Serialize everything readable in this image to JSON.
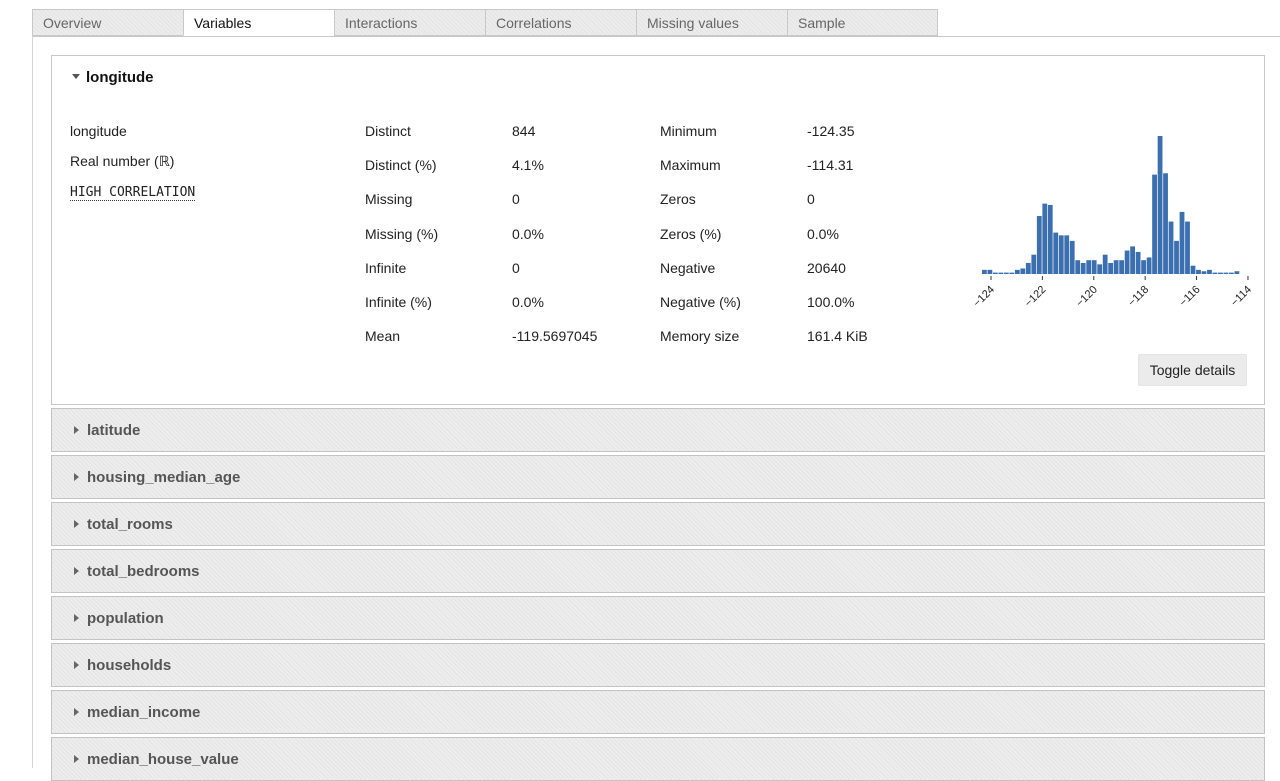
{
  "tabs": [
    "Overview",
    "Variables",
    "Interactions",
    "Correlations",
    "Missing values",
    "Sample"
  ],
  "active_tab": "Variables",
  "variable": {
    "name": "longitude",
    "display_name": "longitude",
    "type": "Real number (ℝ)",
    "alert": "HIGH CORRELATION",
    "stats_left": [
      {
        "label": "Distinct",
        "value": "844"
      },
      {
        "label": "Distinct (%)",
        "value": "4.1%"
      },
      {
        "label": "Missing",
        "value": "0"
      },
      {
        "label": "Missing (%)",
        "value": "0.0%"
      },
      {
        "label": "Infinite",
        "value": "0"
      },
      {
        "label": "Infinite (%)",
        "value": "0.0%"
      },
      {
        "label": "Mean",
        "value": "-119.5697045"
      }
    ],
    "stats_right": [
      {
        "label": "Minimum",
        "value": "-124.35"
      },
      {
        "label": "Maximum",
        "value": "-114.31"
      },
      {
        "label": "Zeros",
        "value": "0"
      },
      {
        "label": "Zeros (%)",
        "value": "0.0%"
      },
      {
        "label": "Negative",
        "value": "20640"
      },
      {
        "label": "Negative (%)",
        "value": "100.0%"
      },
      {
        "label": "Memory size",
        "value": "161.4 KiB"
      }
    ],
    "toggle_label": "Toggle details"
  },
  "chart_data": {
    "type": "bar",
    "bar_color": "#3c6fb0",
    "xlim": [
      -124.35,
      -114.31
    ],
    "ticks": [
      "−124",
      "−122",
      "−120",
      "−118",
      "−116",
      "−114"
    ],
    "tick_values": [
      -124,
      -122,
      -120,
      -118,
      -116,
      -114
    ],
    "values": [
      3,
      3,
      1,
      1,
      1,
      1,
      3,
      4,
      8,
      14,
      42,
      51,
      50,
      30,
      28,
      28,
      24,
      10,
      8,
      10,
      10,
      7,
      14,
      8,
      10,
      10,
      17,
      20,
      16,
      10,
      12,
      72,
      100,
      73,
      38,
      24,
      45,
      38,
      6,
      3,
      2,
      3,
      1,
      1,
      1,
      1,
      2
    ]
  },
  "collapsed_variables": [
    "latitude",
    "housing_median_age",
    "total_rooms",
    "total_bedrooms",
    "population",
    "households",
    "median_income",
    "median_house_value"
  ]
}
